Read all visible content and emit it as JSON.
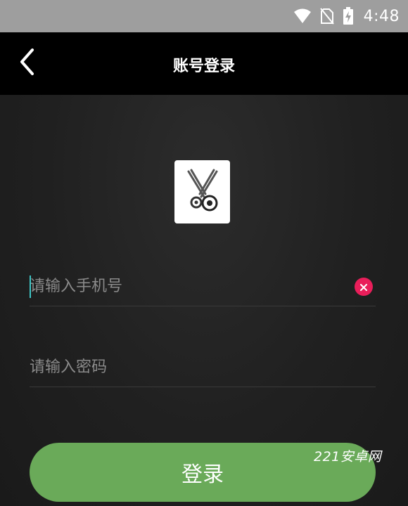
{
  "status_bar": {
    "time": "4:48",
    "icons": [
      "wifi-icon",
      "no-sim-icon",
      "battery-charging-icon"
    ]
  },
  "nav": {
    "back_icon": "chevron-left-icon",
    "title": "账号登录"
  },
  "logo": {
    "icon": "scissors-icon"
  },
  "form": {
    "phone_placeholder": "请输入手机号",
    "phone_value": "",
    "clear_icon": "clear-x-icon",
    "password_placeholder": "请输入密码",
    "password_value": ""
  },
  "login_button": {
    "label": "登录"
  },
  "watermark": {
    "text": "221安卓网"
  },
  "colors": {
    "status_bar": "#9e9e9e",
    "nav_bar": "#000000",
    "background": "#1f1f1f",
    "accent_green": "#6aaa59",
    "clear_red": "#e91e5a",
    "cursor": "#3ec6c6"
  }
}
